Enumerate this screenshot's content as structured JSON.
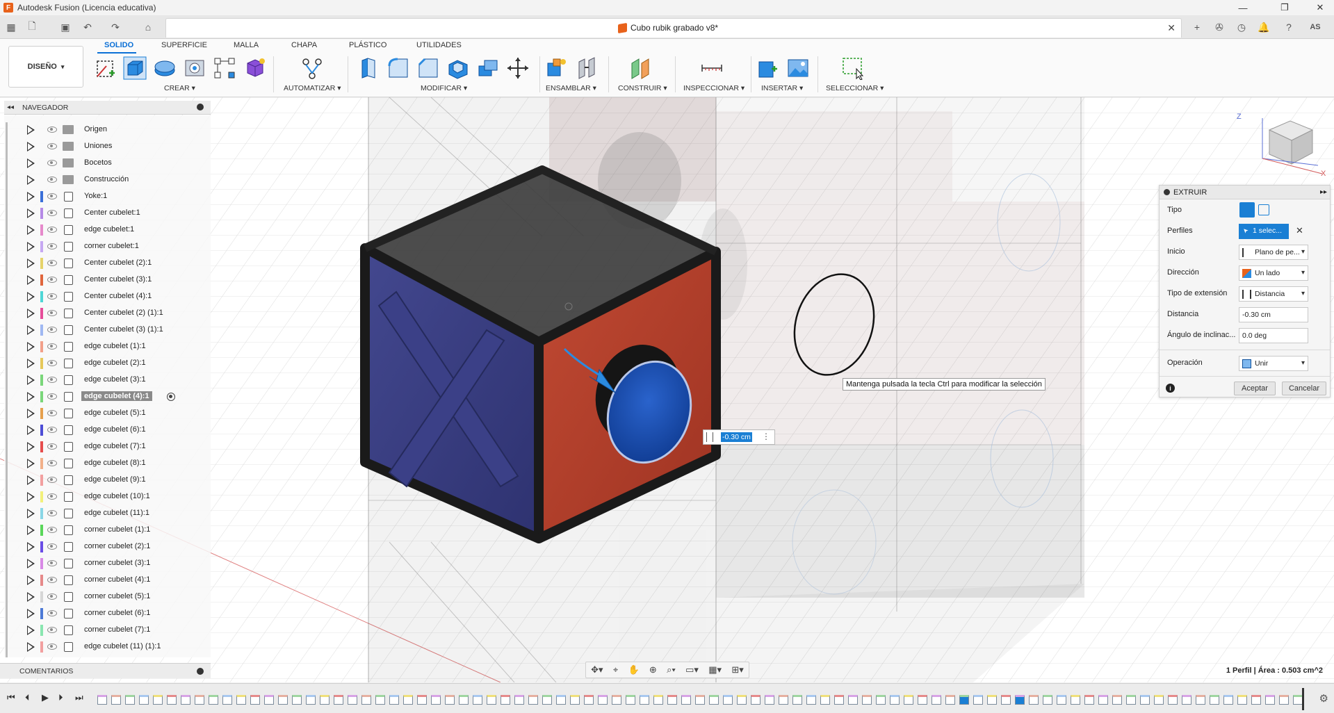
{
  "window": {
    "title": "Autodesk Fusion (Licencia educativa)",
    "controls": [
      "—",
      "❐",
      "✕"
    ]
  },
  "document": {
    "tab_title": "Cubo rubik grabado v8*",
    "close": "✕",
    "user_initials": "AS"
  },
  "ribbon": {
    "workspace": "DISEÑO",
    "tabs": [
      "SOLIDO",
      "SUPERFICIE",
      "MALLA",
      "CHAPA",
      "PLÁSTICO",
      "UTILIDADES"
    ],
    "active_tab": "SOLIDO",
    "groups": [
      "CREAR ▾",
      "AUTOMATIZAR ▾",
      "MODIFICAR ▾",
      "ENSAMBLAR ▾",
      "CONSTRUIR ▾",
      "INSPECCIONAR ▾",
      "INSERTAR ▾",
      "SELECCIONAR ▾"
    ]
  },
  "navigator": {
    "header": "NAVEGADOR",
    "items": [
      {
        "label": "Origen",
        "type": "folder",
        "color": ""
      },
      {
        "label": "Uniones",
        "type": "folder",
        "color": ""
      },
      {
        "label": "Bocetos",
        "type": "folder",
        "color": ""
      },
      {
        "label": "Construcción",
        "type": "folder",
        "color": ""
      },
      {
        "label": "Yoke:1",
        "type": "comp",
        "color": "#3a6fd8"
      },
      {
        "label": "Center cubelet:1",
        "type": "comp",
        "color": "#b58ae6"
      },
      {
        "label": "edge cubelet:1",
        "type": "comp",
        "color": "#e68acb"
      },
      {
        "label": "corner cubelet:1",
        "type": "comp",
        "color": "#c6a8f2"
      },
      {
        "label": "Center cubelet (2):1",
        "type": "comp",
        "color": "#e6d36a"
      },
      {
        "label": "Center cubelet (3):1",
        "type": "comp",
        "color": "#e0663d"
      },
      {
        "label": "Center cubelet (4):1",
        "type": "comp",
        "color": "#4fd6d6"
      },
      {
        "label": "Center cubelet (2) (1):1",
        "type": "comp",
        "color": "#e64d9a"
      },
      {
        "label": "Center cubelet (3) (1):1",
        "type": "comp",
        "color": "#a0b8f2"
      },
      {
        "label": "edge cubelet (1):1",
        "type": "comp",
        "color": "#f2a08a"
      },
      {
        "label": "edge cubelet (2):1",
        "type": "comp",
        "color": "#e6c85a"
      },
      {
        "label": "edge cubelet (3):1",
        "type": "comp",
        "color": "#7ad67a"
      },
      {
        "label": "edge cubelet (4):1",
        "type": "comp",
        "color": "#7ad67a"
      },
      {
        "label": "edge cubelet (5):1",
        "type": "comp",
        "color": "#e6a04d"
      },
      {
        "label": "edge cubelet (6):1",
        "type": "comp",
        "color": "#4d4dd6"
      },
      {
        "label": "edge cubelet (7):1",
        "type": "comp",
        "color": "#e64d4d"
      },
      {
        "label": "edge cubelet (8):1",
        "type": "comp",
        "color": "#f2b08a"
      },
      {
        "label": "edge cubelet (9):1",
        "type": "comp",
        "color": "#f2a0a0"
      },
      {
        "label": "edge cubelet (10):1",
        "type": "comp",
        "color": "#f2f07a"
      },
      {
        "label": "edge cubelet (11):1",
        "type": "comp",
        "color": "#8ad6e6"
      },
      {
        "label": "corner cubelet (1):1",
        "type": "comp",
        "color": "#5ad65a"
      },
      {
        "label": "corner cubelet (2):1",
        "type": "comp",
        "color": "#6a4de6"
      },
      {
        "label": "corner cubelet (3):1",
        "type": "comp",
        "color": "#d88ae6"
      },
      {
        "label": "corner cubelet (4):1",
        "type": "comp",
        "color": "#e68a8a"
      },
      {
        "label": "corner cubelet (5):1",
        "type": "comp",
        "color": "#d6d6d6"
      },
      {
        "label": "corner cubelet (6):1",
        "type": "comp",
        "color": "#4d7ad6"
      },
      {
        "label": "corner cubelet (7):1",
        "type": "comp",
        "color": "#8ae6b0"
      },
      {
        "label": "edge cubelet (11) (1):1",
        "type": "comp",
        "color": "#f2a0a0"
      }
    ],
    "selected_index": 16
  },
  "comments": {
    "label": "COMENTARIOS"
  },
  "extrude": {
    "title": "EXTRUIR",
    "rows": {
      "tipo": "Tipo",
      "perfiles": "Perfiles",
      "perfiles_value": "1 selec...",
      "inicio": "Inicio",
      "inicio_value": "Plano de pe...",
      "direccion": "Dirección",
      "direccion_value": "Un lado",
      "tipo_ext": "Tipo de extensión",
      "tipo_ext_value": "Distancia",
      "distancia": "Distancia",
      "distancia_value": "-0.30 cm",
      "angulo": "Ángulo de inclinac...",
      "angulo_value": "0.0 deg",
      "operacion": "Operación",
      "operacion_value": "Unir"
    },
    "accept": "Aceptar",
    "cancel": "Cancelar"
  },
  "viewport": {
    "tooltip": "Mantenga pulsada la tecla Ctrl para modificar la selección",
    "value_input": "-0.30 cm",
    "status": "1 Perfil | Área : 0.503 cm^2",
    "viewcube_axis_z": "Z",
    "viewcube_axis_x": "X"
  },
  "colors": {
    "accent": "#0a6fd6",
    "cube_blue": "#3a3f8a",
    "cube_red": "#b7402c",
    "cube_black": "#1c1c1c",
    "cap_blue": "#1b52b8"
  }
}
